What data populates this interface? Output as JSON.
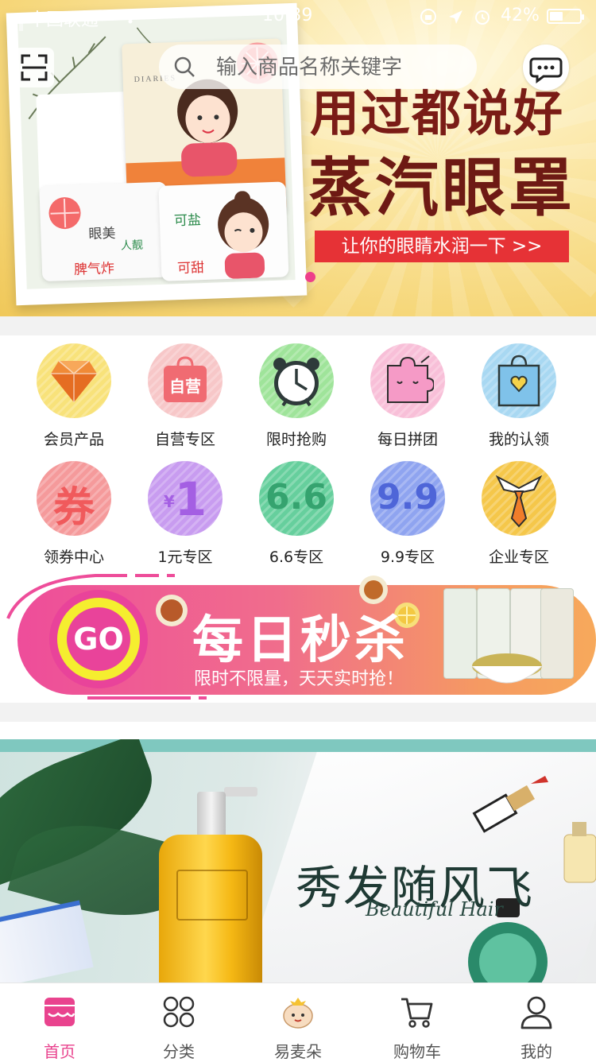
{
  "status_bar": {
    "carrier": "中国联通",
    "time": "10:39",
    "battery": "42%"
  },
  "search": {
    "placeholder": "输入商品名称关键字"
  },
  "hero_banner": {
    "headline": "用过都说好",
    "title": "蒸汽眼罩",
    "cta": "让你的眼睛水润一下 >>",
    "package_brand": "DIARIES",
    "mask_texts": [
      "眼美",
      "人靓",
      "脾气炸",
      "可盐",
      "可甜"
    ]
  },
  "grid": {
    "row1": [
      {
        "label": "会员产品",
        "icon": "diamond-icon",
        "color": "#f8e27a"
      },
      {
        "label": "自营专区",
        "icon": "self-operated-bag-icon",
        "badge": "自营",
        "color": "#f7c7c8"
      },
      {
        "label": "限时抢购",
        "icon": "alarm-clock-icon",
        "color": "#9fe49a"
      },
      {
        "label": "每日拼团",
        "icon": "puzzle-icon",
        "color": "#f8bfd8"
      },
      {
        "label": "我的认领",
        "icon": "shopping-bag-heart-icon",
        "color": "#a8d8f2"
      }
    ],
    "row2": [
      {
        "label": "领券中心",
        "icon": "coupon-icon",
        "badge": "券",
        "color": "#f59a9b"
      },
      {
        "label": "1元专区",
        "icon": "one-yuan-icon",
        "badge_prefix": "¥",
        "badge": "1",
        "color": "#c89cf0"
      },
      {
        "label": "6.6专区",
        "icon": "six-six-icon",
        "badge": "6.6",
        "color": "#66cf9d"
      },
      {
        "label": "9.9专区",
        "icon": "nine-nine-icon",
        "badge": "9.9",
        "color": "#8fa4f0"
      },
      {
        "label": "企业专区",
        "icon": "necktie-icon",
        "color": "#f5c74a"
      }
    ]
  },
  "flash_sale": {
    "go_label": "GO",
    "title": "每日秒杀",
    "subtitle": "限时不限量，天天实时抢！"
  },
  "promo_banner": {
    "title": "秀发随风飞",
    "subtitle": "Beautiful Hair"
  },
  "tabbar": [
    {
      "label": "首页",
      "icon": "home-shop-icon",
      "active": true
    },
    {
      "label": "分类",
      "icon": "category-grid-icon",
      "active": false
    },
    {
      "label": "易麦朵",
      "icon": "mascot-icon",
      "active": false
    },
    {
      "label": "购物车",
      "icon": "cart-icon",
      "active": false
    },
    {
      "label": "我的",
      "icon": "profile-icon",
      "active": false
    }
  ],
  "colors": {
    "accent": "#e9438e",
    "cta_red": "#e63236",
    "gap_gray": "#f2f2f2"
  }
}
